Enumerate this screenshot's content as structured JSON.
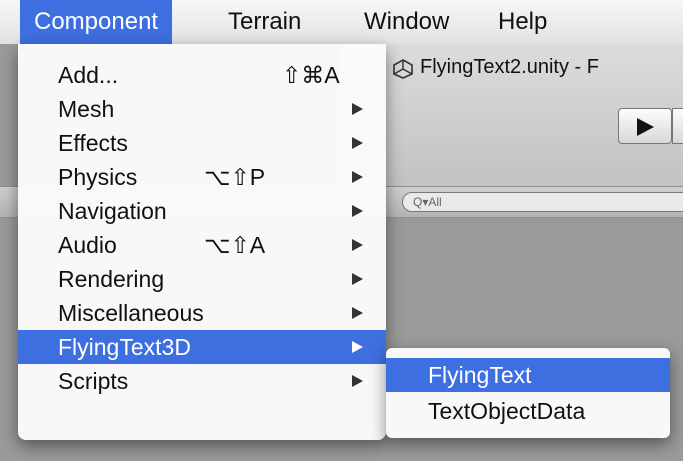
{
  "menubar": {
    "items": [
      {
        "label": "Component",
        "active": true
      },
      {
        "label": "Terrain"
      },
      {
        "label": "Window"
      },
      {
        "label": "Help"
      }
    ]
  },
  "window": {
    "title": "FlyingText2.unity - F",
    "search_placeholder": "Q▾All"
  },
  "component_menu": {
    "items": [
      {
        "label": "Add...",
        "shortcut": "⇧⌘A",
        "submenu": false
      },
      {
        "label": "Mesh",
        "shortcut": "",
        "submenu": true
      },
      {
        "label": "Effects",
        "shortcut": "",
        "submenu": true
      },
      {
        "label": "Physics",
        "shortcut": "⌥⇧P",
        "submenu": true
      },
      {
        "label": "Navigation",
        "shortcut": "",
        "submenu": true
      },
      {
        "label": "Audio",
        "shortcut": "⌥⇧A",
        "submenu": true
      },
      {
        "label": "Rendering",
        "shortcut": "",
        "submenu": true
      },
      {
        "label": "Miscellaneous",
        "shortcut": "",
        "submenu": true
      },
      {
        "label": "FlyingText3D",
        "shortcut": "",
        "submenu": true,
        "highlighted": true
      },
      {
        "label": "Scripts",
        "shortcut": "",
        "submenu": true
      }
    ]
  },
  "flyingtext3d_submenu": {
    "items": [
      {
        "label": "FlyingText",
        "highlighted": true
      },
      {
        "label": "TextObjectData"
      }
    ]
  },
  "colors": {
    "highlight": "#3d6fe0"
  }
}
